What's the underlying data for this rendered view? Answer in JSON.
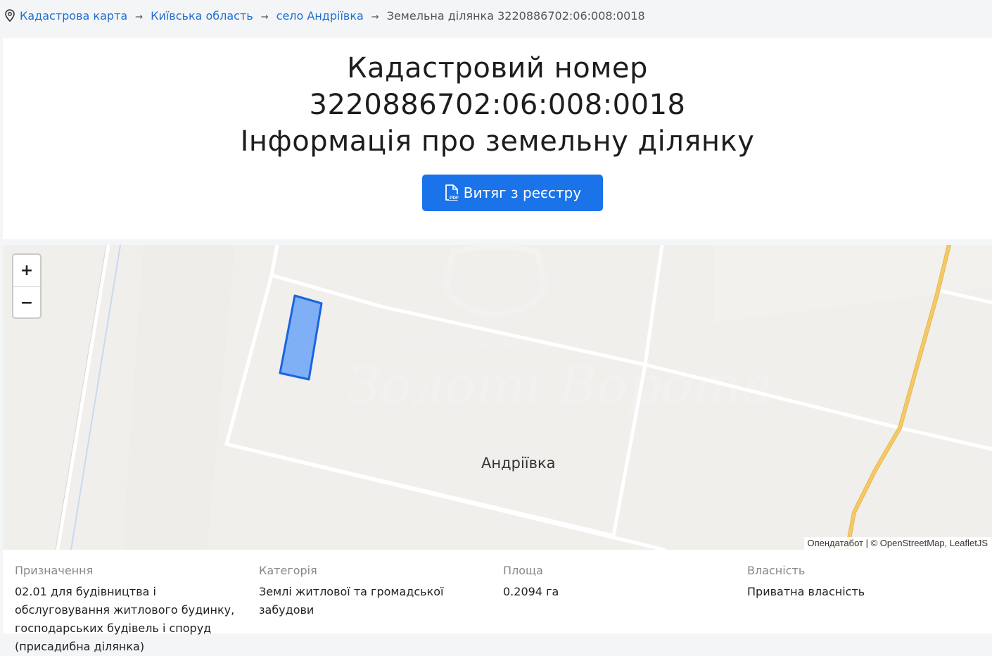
{
  "breadcrumb": {
    "icon": "location-pin-icon",
    "items": [
      "Кадастрова карта",
      "Київська область",
      "село Андріївка"
    ],
    "current": "Земельна ділянка 3220886702:06:008:0018",
    "separator": "→"
  },
  "header": {
    "line1": "Кадастровий номер",
    "line2": "3220886702:06:008:0018",
    "line3": "Інформація про земельну ділянку",
    "button_label": "Витяг з реєстру",
    "button_icon": "pdf-file-icon",
    "accent": "#1a73e8"
  },
  "map": {
    "zoom_in": "+",
    "zoom_out": "−",
    "place_label": "Андріївка",
    "watermark_line1": "рієлторська компанія",
    "watermark_line2": "Золоті Ворота",
    "attribution": {
      "part1": "Опендатабот",
      "separator": " | © ",
      "part2": "OpenStreetMap",
      "comma": ", ",
      "part3": "LeafletJS"
    },
    "parcel_color": "#7fb0f5",
    "road_color": "#f5c869"
  },
  "info": {
    "purpose": {
      "label": "Призначення",
      "value": "02.01 для будівництва і обслуговування житлового будинку, господарських будівель і споруд (присадибна ділянка)"
    },
    "category": {
      "label": "Категорія",
      "value": "Землі житлової та громадської забудови"
    },
    "area": {
      "label": "Площа",
      "value": "0.2094 га"
    },
    "ownership": {
      "label": "Власність",
      "value": "Приватна власність"
    }
  }
}
